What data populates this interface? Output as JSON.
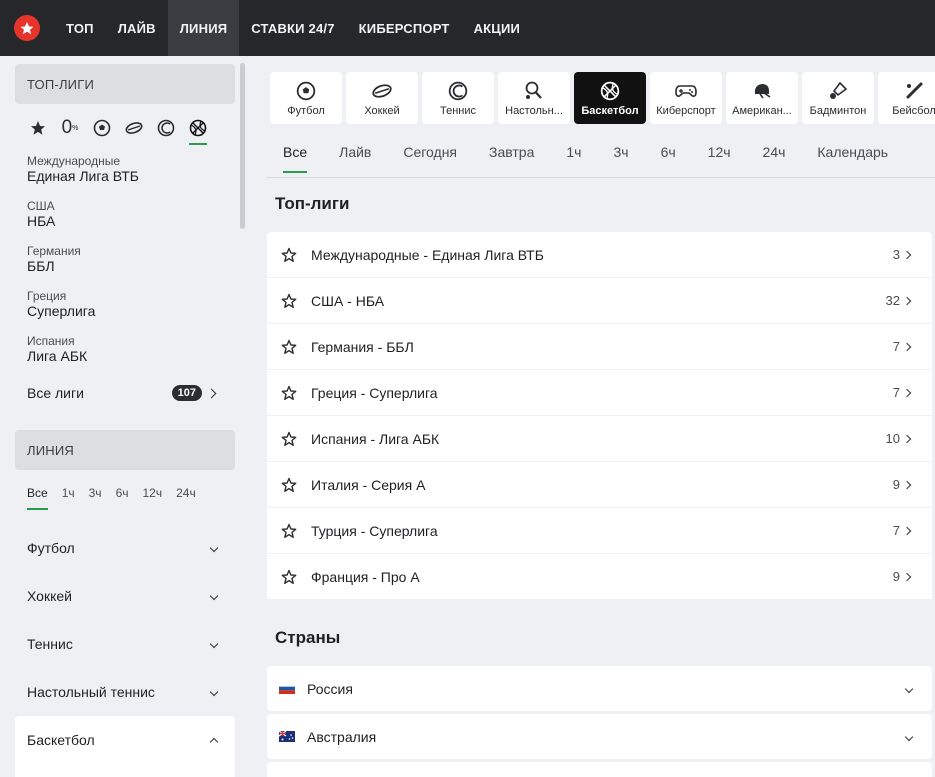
{
  "nav": {
    "items": [
      "ТОП",
      "ЛАЙВ",
      "ЛИНИЯ",
      "СТАВКИ 24/7",
      "КИБЕРСПОРТ",
      "АКЦИИ"
    ],
    "active": "ЛИНИЯ"
  },
  "sidebar": {
    "top_leagues_title": "ТОП-ЛИГИ",
    "percent_icon_label": "0",
    "leagues": [
      {
        "country": "Международные",
        "name": "Единая Лига ВТБ"
      },
      {
        "country": "США",
        "name": "НБА"
      },
      {
        "country": "Германия",
        "name": "ББЛ"
      },
      {
        "country": "Греция",
        "name": "Суперлига"
      },
      {
        "country": "Испания",
        "name": "Лига АБК"
      }
    ],
    "all_leagues_label": "Все лиги",
    "all_leagues_count": "107",
    "line_title": "ЛИНИЯ",
    "time_tabs": [
      "Все",
      "1ч",
      "3ч",
      "6ч",
      "12ч",
      "24ч"
    ],
    "sports": [
      "Футбол",
      "Хоккей",
      "Теннис",
      "Настольный теннис",
      "Баскетбол"
    ]
  },
  "main": {
    "sport_tabs": [
      "Футбол",
      "Хоккей",
      "Теннис",
      "Настольн...",
      "Баскетбол",
      "Киберспорт",
      "Американ...",
      "Бадминтон",
      "Бейсбол"
    ],
    "filter_tabs": [
      "Все",
      "Лайв",
      "Сегодня",
      "Завтра",
      "1ч",
      "3ч",
      "6ч",
      "12ч",
      "24ч",
      "Календарь"
    ],
    "top_leagues_heading": "Топ-лиги",
    "top_leagues": [
      {
        "name": "Международные - Единая Лига ВТБ",
        "count": "3"
      },
      {
        "name": "США - НБА",
        "count": "32"
      },
      {
        "name": "Германия - ББЛ",
        "count": "7"
      },
      {
        "name": "Греция - Суперлига",
        "count": "7"
      },
      {
        "name": "Испания - Лига АБК",
        "count": "10"
      },
      {
        "name": "Италия - Серия А",
        "count": "9"
      },
      {
        "name": "Турция - Суперлига",
        "count": "7"
      },
      {
        "name": "Франция - Про А",
        "count": "9"
      }
    ],
    "countries_heading": "Страны",
    "countries": [
      "Россия",
      "Австралия"
    ]
  },
  "colors": {
    "accent": "#2a9d4a",
    "nav_bg": "#25272b",
    "logo": "#e7342b"
  }
}
